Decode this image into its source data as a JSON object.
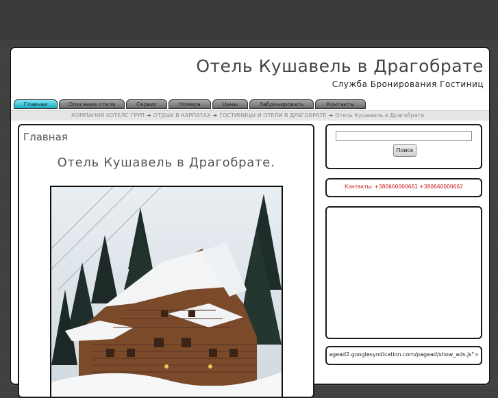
{
  "header": {
    "title": "Отель Кушавель в Драгобрате",
    "subtitle": "Служба Бронирования Гостиниц"
  },
  "nav": {
    "tabs": [
      {
        "label": "Главная",
        "active": true
      },
      {
        "label": "Описание отеля",
        "active": false
      },
      {
        "label": "Сервис",
        "active": false
      },
      {
        "label": "Номера",
        "active": false
      },
      {
        "label": "Цены",
        "active": false
      },
      {
        "label": "Забронировать",
        "active": false
      },
      {
        "label": "Контакты",
        "active": false
      }
    ]
  },
  "breadcrumb": {
    "items": [
      "КОМПАНИЯ ХОТЕЛС ГРУП",
      "ОТДЫХ В КАРПАТАХ",
      "ГОСТИНИЦЫ И ОТЕЛИ В ДРАГОБРАТЕ",
      "Отель Кушавель в Драгобрате"
    ],
    "separator": "➜"
  },
  "main": {
    "heading": "Главная",
    "hotel_title": "Отель Кушавель в Драгобрате.",
    "photo_icon": "hotel-photo-icon"
  },
  "sidebar": {
    "search": {
      "value": "",
      "button_label": "Поиск"
    },
    "contacts": "Контакты: +380660000661 +380660000662",
    "ads_script_text": "agead2.googlesyndication.com/pagead/show_ads.js\">"
  },
  "colors": {
    "active_tab": "#1aa9c0",
    "contacts_text": "#cc1111",
    "page_background": "#3f3f3f"
  }
}
